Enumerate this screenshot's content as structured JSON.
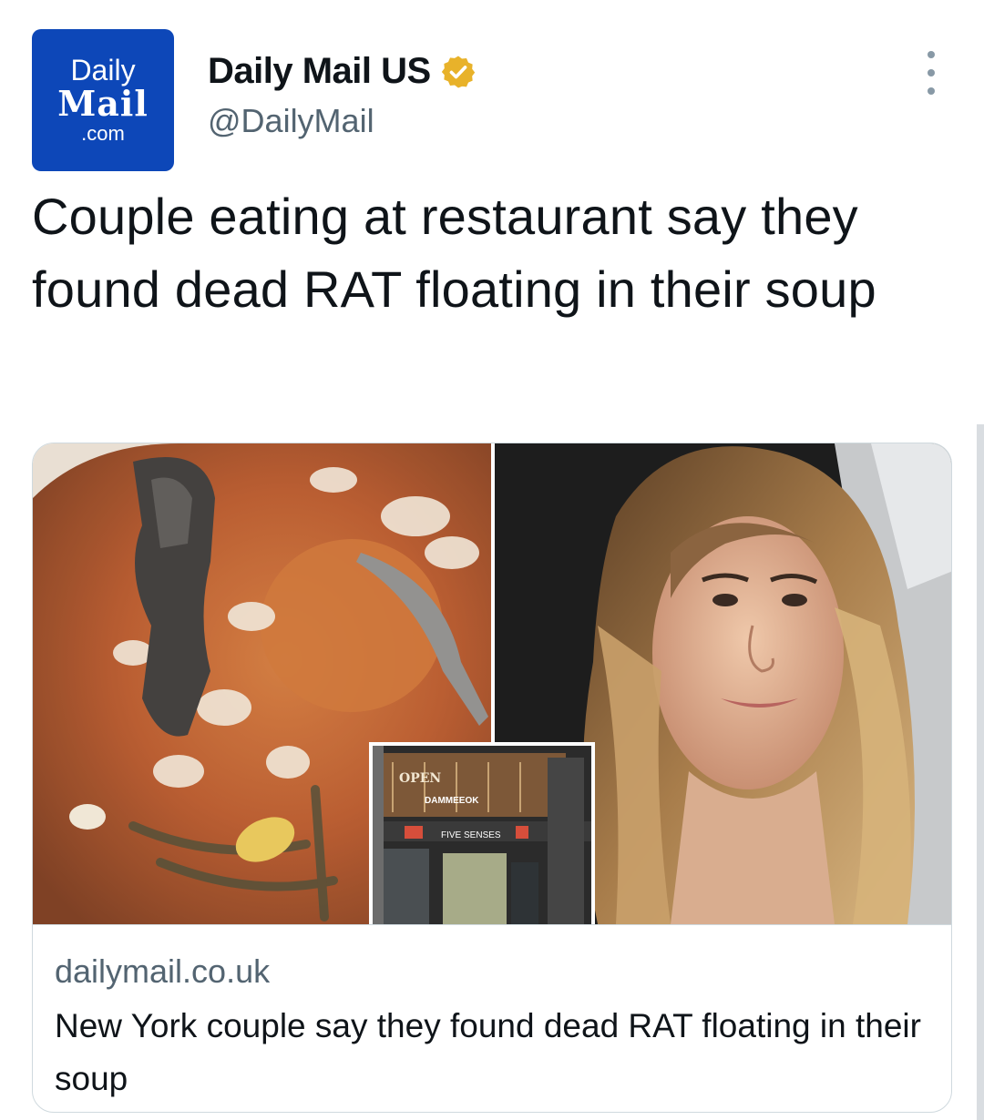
{
  "account": {
    "avatar_line1": "Daily",
    "avatar_line2": "Mail",
    "avatar_line3": ".com",
    "display_name": "Daily Mail US",
    "handle": "@DailyMail",
    "verified": true,
    "verified_icon": "verified-badge-icon",
    "brand_color": "#0d47b8",
    "badge_color": "#e8b22a"
  },
  "more_icon": "more-vertical-icon",
  "tweet": {
    "text": "Couple eating at restaurant say they found dead RAT floating in their soup"
  },
  "card": {
    "domain": "dailymail.co.uk",
    "title": "New York couple say they found dead RAT floating in their soup",
    "inset_sign_open": "OPEN",
    "inset_sign_name": "DAMMEEOK",
    "inset_sign_senses": "FIVE SENSES"
  }
}
